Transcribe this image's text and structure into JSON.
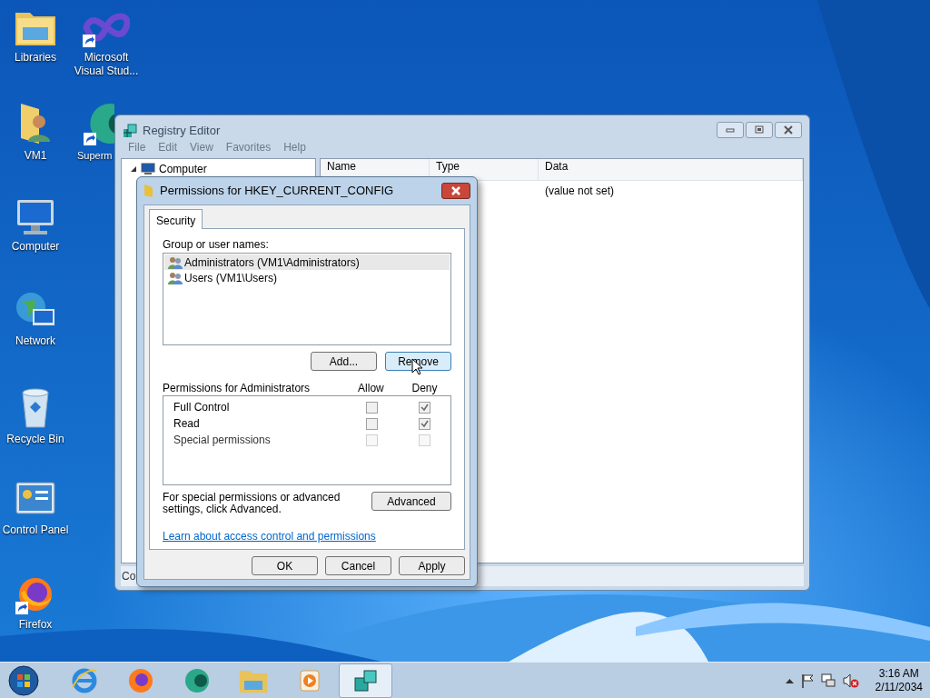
{
  "desktop_icons": [
    {
      "label": "Libraries",
      "shortcut": false
    },
    {
      "label": "VM1",
      "shortcut": false
    },
    {
      "label": "Computer",
      "shortcut": false
    },
    {
      "label": "Network",
      "shortcut": false
    },
    {
      "label": "Recycle Bin",
      "shortcut": false
    },
    {
      "label": "Control Panel",
      "shortcut": false
    },
    {
      "label": "Firefox",
      "shortcut": true
    }
  ],
  "desktop_icons_column_2": [
    {
      "label": "Microsoft Visual Stud...",
      "shortcut": true
    },
    {
      "label": "Superm",
      "shortcut": true
    }
  ],
  "registry_window": {
    "title": "Registry Editor",
    "menu": [
      "File",
      "Edit",
      "View",
      "Favorites",
      "Help"
    ],
    "tree": [
      {
        "label": "Computer",
        "expanded": true
      }
    ],
    "columns": [
      "Name",
      "Type",
      "Data"
    ],
    "rows": [
      {
        "data": "(value not set)"
      }
    ],
    "status_bar": "Co"
  },
  "dialog": {
    "title": "Permissions for HKEY_CURRENT_CONFIG",
    "tabs": [
      {
        "label": "Security",
        "selected": true
      }
    ],
    "group_label": "Group or user names:",
    "users": [
      {
        "label": "Administrators (VM1\\Administrators)",
        "selected": true
      },
      {
        "label": "Users (VM1\\Users)",
        "selected": false
      }
    ],
    "user_buttons": [
      {
        "label": "Add...",
        "hovered": false
      },
      {
        "label": "Remove",
        "hovered": true
      }
    ],
    "permissions_label": "Permissions for Administrators",
    "allow_label": "Allow",
    "deny_label": "Deny",
    "permissions": [
      {
        "label": "Full Control",
        "allow": false,
        "deny": true,
        "disabled": false
      },
      {
        "label": "Read",
        "allow": false,
        "deny": true,
        "disabled": false
      },
      {
        "label": "Special permissions",
        "allow": false,
        "deny": false,
        "disabled": true
      }
    ],
    "advanced_text": "For special permissions or advanced settings, click Advanced.",
    "advanced_button": "Advanced",
    "link": "Learn about access control and permissions",
    "buttons": [
      "OK",
      "Cancel",
      "Apply"
    ]
  },
  "taskbar": {
    "items": [
      {
        "active": false
      },
      {
        "active": false
      },
      {
        "active": false
      },
      {
        "active": false
      },
      {
        "active": false
      },
      {
        "active": true
      }
    ],
    "time": "3:16 AM",
    "date": "2/11/2034"
  }
}
